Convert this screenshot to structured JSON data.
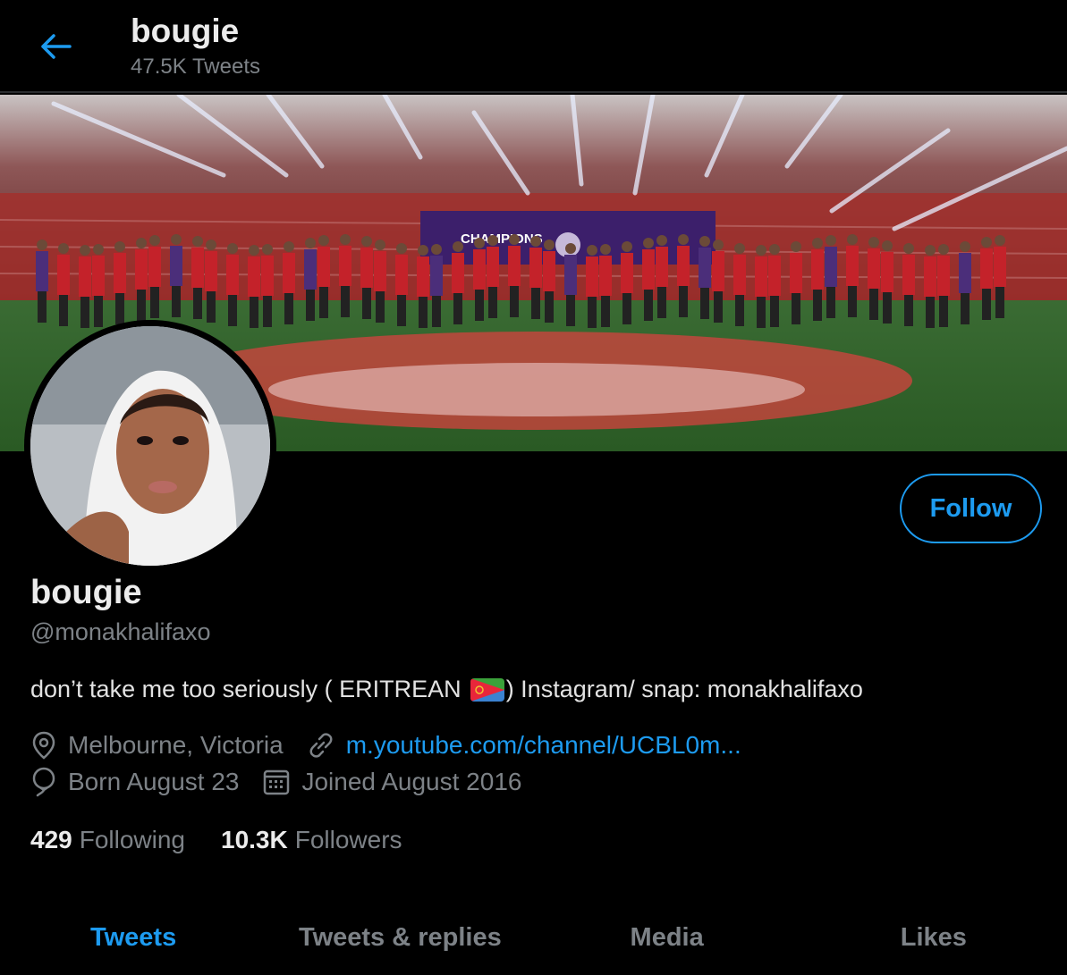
{
  "header": {
    "title": "bougie",
    "subtitle": "47.5K Tweets"
  },
  "profile": {
    "name": "bougie",
    "handle": "@monakhalifaxo",
    "bio_before_flag": "don’t take me too seriously ( ERITREAN ",
    "bio_after_flag": ") Instagram/ snap: monakhalifaxo",
    "location": "Melbourne, Victoria",
    "website": "m.youtube.com/channel/UCBL0m...",
    "birthday": "Born August 23",
    "joined": "Joined August 2016"
  },
  "follow_button": {
    "label": "Follow"
  },
  "stats": {
    "following_count": "429",
    "following_label": "Following",
    "followers_count": "10.3K",
    "followers_label": "Followers"
  },
  "tabs": [
    {
      "label": "Tweets",
      "active": true
    },
    {
      "label": "Tweets & replies",
      "active": false
    },
    {
      "label": "Media",
      "active": false
    },
    {
      "label": "Likes",
      "active": false
    }
  ],
  "banner": {
    "text": "CHAMPIONS"
  },
  "colors": {
    "accent": "#1d9bf0",
    "background": "#000000",
    "muted": "#7d8287"
  }
}
